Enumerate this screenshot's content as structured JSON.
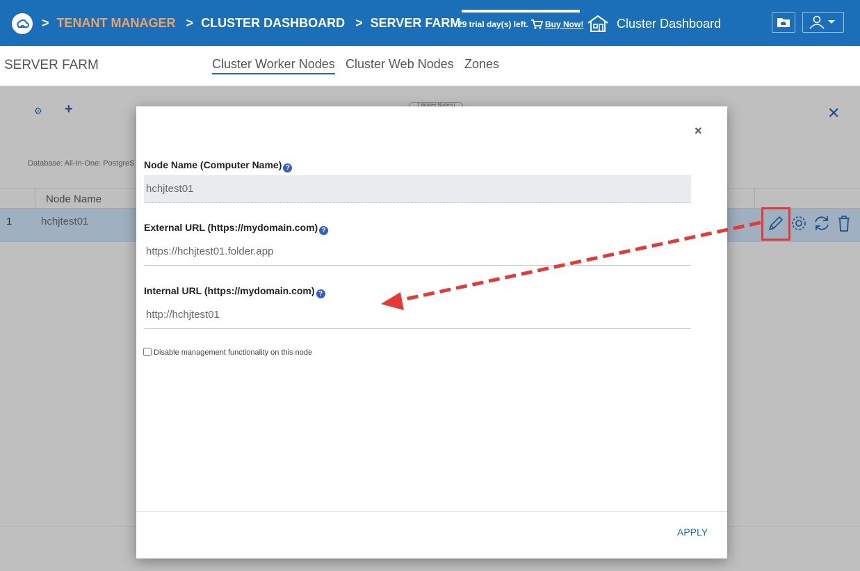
{
  "header": {
    "breadcrumb": {
      "sep1": ">",
      "tenant_manager": "TENANT MANAGER",
      "sep2": ">",
      "cluster_dashboard": "CLUSTER DASHBOARD",
      "sep3": ">",
      "server_farm": "SERVER FARM"
    },
    "trial_text": "29 trial day(s) left.",
    "buy_now": "Buy Now!",
    "dashboard_title": "Cluster Dashboard"
  },
  "subheader": {
    "title": "SERVER FARM",
    "tabs": [
      {
        "label": "Cluster Worker Nodes",
        "active": true
      },
      {
        "label": "Cluster Web Nodes",
        "active": false
      },
      {
        "label": "Zones",
        "active": false
      }
    ]
  },
  "background": {
    "badge": "1 Worker Node(s)",
    "database_text": "Database: All-In-One: PostgreS",
    "table_header": "Node Name",
    "row": {
      "num": "1",
      "name": "hchjtest01"
    }
  },
  "modal": {
    "node_name_label": "Node Name (Computer Name)",
    "node_name_value": "hchjtest01",
    "external_url_label": "External URL (https://mydomain.com)",
    "external_url_value": "https://hchjtest01.folder.app",
    "internal_url_label": "Internal URL (https://mydomain.com)",
    "internal_url_value": "http://hchjtest01",
    "disable_checkbox_label": "Disable management functionality on this node",
    "help_glyph": "?",
    "close_glyph": "×",
    "apply_label": "APPLY"
  },
  "colors": {
    "brand": "#1a6fb8",
    "breadcrumb_accent": "#f0a35f",
    "annotation_red": "#e53935"
  }
}
